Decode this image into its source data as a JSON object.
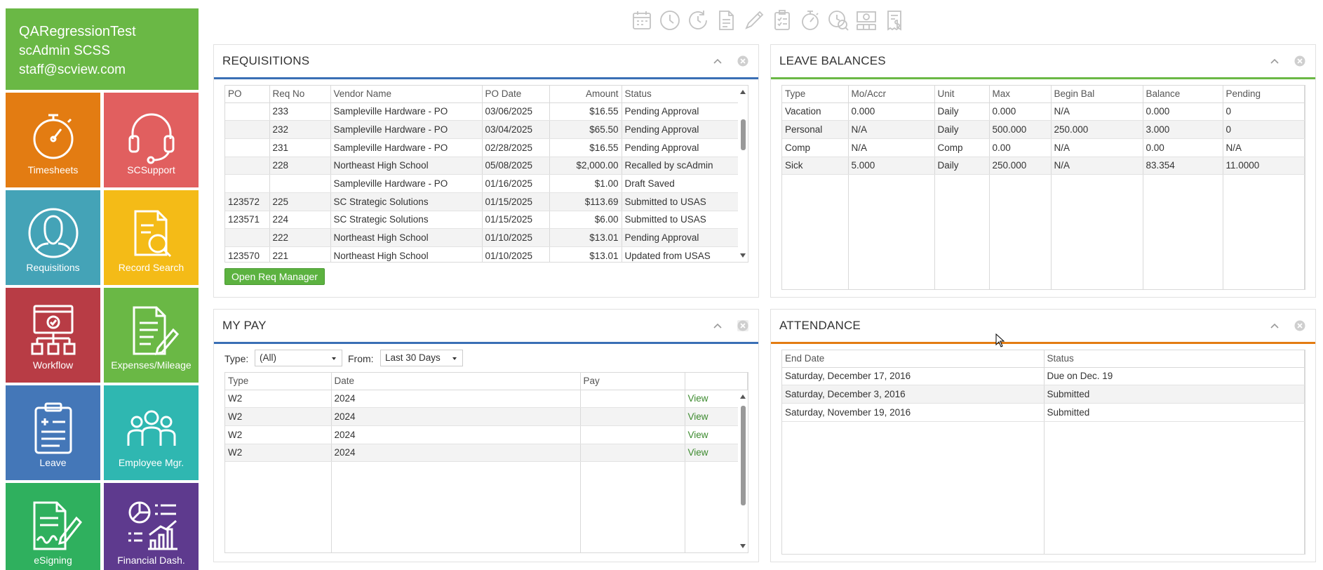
{
  "user": {
    "org": "QARegressionTest",
    "name": "scAdmin SCSS",
    "email": "staff@scview.com"
  },
  "tiles": [
    {
      "label": "Timesheets",
      "icon": "stopwatch-icon",
      "color": "#e37c12"
    },
    {
      "label": "SCSupport",
      "icon": "headset-icon",
      "color": "#e15f5f"
    },
    {
      "label": "Requisitions",
      "icon": "person-icon",
      "color": "#44a3b7"
    },
    {
      "label": "Record Search",
      "icon": "document-search-icon",
      "color": "#f4bb17"
    },
    {
      "label": "Workflow",
      "icon": "workflow-icon",
      "color": "#b83c45"
    },
    {
      "label": "Expenses/Mileage",
      "icon": "document-pen-icon",
      "color": "#6ab845"
    },
    {
      "label": "Leave",
      "icon": "clipboard-icon",
      "color": "#4477b8"
    },
    {
      "label": "Employee Mgr.",
      "icon": "group-icon",
      "color": "#2fb7b1"
    },
    {
      "label": "eSigning",
      "icon": "signature-icon",
      "color": "#2fb05e"
    },
    {
      "label": "Financial Dash.",
      "icon": "dashboard-chart-icon",
      "color": "#5e3a8e"
    }
  ],
  "toolbar": [
    "calendar-icon",
    "clock-icon",
    "refresh-clock-icon",
    "document-icon",
    "pencil-icon",
    "checklist-icon",
    "stopwatch-icon",
    "search-clock-icon",
    "money-grid-icon",
    "invoice-icon"
  ],
  "requisitions": {
    "title": "REQUISITIONS",
    "accent": "#3a6fb5",
    "columns": [
      "PO",
      "Req No",
      "Vendor Name",
      "PO Date",
      "Amount",
      "Status"
    ],
    "rows": [
      [
        "",
        "233",
        "Sampleville Hardware - PO",
        "03/06/2025",
        "$16.55",
        "Pending Approval"
      ],
      [
        "",
        "232",
        "Sampleville Hardware - PO",
        "03/04/2025",
        "$65.50",
        "Pending Approval"
      ],
      [
        "",
        "231",
        "Sampleville Hardware - PO",
        "02/28/2025",
        "$16.55",
        "Pending Approval"
      ],
      [
        "",
        "228",
        "Northeast High School",
        "05/08/2025",
        "$2,000.00",
        "Recalled by scAdmin"
      ],
      [
        "",
        "",
        "Sampleville Hardware - PO",
        "01/16/2025",
        "$1.00",
        "Draft Saved"
      ],
      [
        "123572",
        "225",
        "SC Strategic Solutions",
        "01/15/2025",
        "$113.69",
        "Submitted to USAS"
      ],
      [
        "123571",
        "224",
        "SC Strategic Solutions",
        "01/15/2025",
        "$6.00",
        "Submitted to USAS"
      ],
      [
        "",
        "222",
        "Northeast High School",
        "01/10/2025",
        "$13.01",
        "Pending Approval"
      ],
      [
        "123570",
        "221",
        "Northeast High School",
        "01/10/2025",
        "$13.01",
        "Updated from USAS"
      ]
    ],
    "button": "Open Req Manager"
  },
  "leave": {
    "title": "LEAVE BALANCES",
    "accent": "#6ab845",
    "columns": [
      "Type",
      "Mo/Accr",
      "Unit",
      "Max",
      "Begin Bal",
      "Balance",
      "Pending"
    ],
    "rows": [
      [
        "Vacation",
        "0.000",
        "Daily",
        "0.000",
        "N/A",
        "0.000",
        "0"
      ],
      [
        "Personal",
        "N/A",
        "Daily",
        "500.000",
        "250.000",
        "3.000",
        "0"
      ],
      [
        "Comp",
        "N/A",
        "Comp",
        "0.00",
        "N/A",
        "0.00",
        "N/A"
      ],
      [
        "Sick",
        "5.000",
        "Daily",
        "250.000",
        "N/A",
        "83.354",
        "11.0000"
      ]
    ]
  },
  "pay": {
    "title": "MY PAY",
    "accent": "#3a6fb5",
    "type_label": "Type:",
    "type_value": "(All)",
    "from_label": "From:",
    "from_value": "Last 30 Days",
    "columns": [
      "Type",
      "Date",
      "Pay",
      ""
    ],
    "rows": [
      [
        "W2",
        "2024",
        "",
        "View"
      ],
      [
        "W2",
        "2024",
        "",
        "View"
      ],
      [
        "W2",
        "2024",
        "",
        "View"
      ],
      [
        "W2",
        "2024",
        "",
        "View"
      ]
    ]
  },
  "attendance": {
    "title": "ATTENDANCE",
    "accent": "#e37c12",
    "columns": [
      "End Date",
      "Status"
    ],
    "rows": [
      [
        "Saturday, December 17, 2016",
        "Due on Dec. 19"
      ],
      [
        "Saturday, December 3, 2016",
        "Submitted"
      ],
      [
        "Saturday, November 19, 2016",
        "Submitted"
      ]
    ]
  }
}
